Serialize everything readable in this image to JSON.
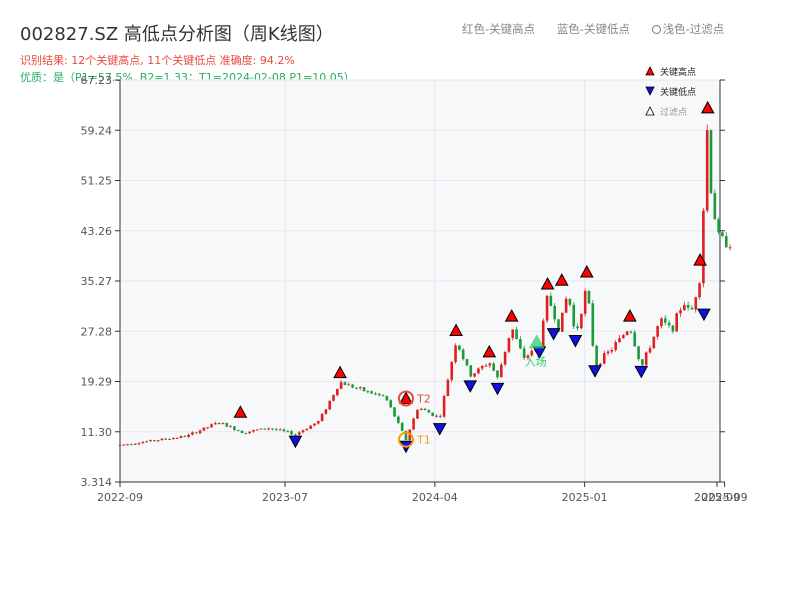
{
  "header": {
    "title": "002827.SZ 高低点分析图（周K线图）",
    "line1": "识别结果: 12个关键高点, 11个关键低点  准确度: 94.2%",
    "line2": "优质：是（P1=57.5%, B2=1.33；T1=2024-02-08 P1=10.05）"
  },
  "top_legend": {
    "red": "红色-关键高点",
    "blue": "蓝色-关键低点",
    "light": "浅色-过滤点"
  },
  "colors": {
    "up": "#e02020",
    "down": "#1a9a3a",
    "high_marker": "#ff0000",
    "low_marker": "#1010e0",
    "t_orange": "#f39c12",
    "t_red": "#e74c3c",
    "entry": "#2ecc71",
    "plot_bg": "#f6f8fa"
  },
  "chart_data": {
    "type": "candlestick",
    "title": "002827.SZ 高低点分析图（周K线图）",
    "xlabel": "",
    "ylabel": "",
    "x_range": [
      "2022-09",
      "2025-09"
    ],
    "x_ticks": [
      "2022-09",
      "2023-07",
      "2024-04",
      "2025-01",
      "2025-09",
      "2025-09"
    ],
    "y_ticks": [
      3.314,
      11.3,
      19.29,
      27.28,
      35.27,
      43.26,
      51.25,
      59.24,
      67.23
    ],
    "y_tick_labels": [
      "3.314",
      "11.30",
      "19.29",
      "27.28",
      "35.27",
      "43.26",
      "51.25",
      "59.24",
      "67.23"
    ],
    "ylim": [
      3.314,
      67.23
    ],
    "grid": true,
    "legend": [
      {
        "name": "关键高点",
        "marker": "triangle-up",
        "color": "#ff0000"
      },
      {
        "name": "关键低点",
        "marker": "triangle-down",
        "color": "#1010e0"
      },
      {
        "name": "过滤点",
        "marker": "triangle-up-outline",
        "color": "#ffffff"
      }
    ],
    "legend_position": "top-right",
    "anchors": [
      [
        "2022-09-01",
        9.2
      ],
      [
        "2022-11-01",
        9.9
      ],
      [
        "2023-01-01",
        10.6
      ],
      [
        "2023-03-01",
        12.8
      ],
      [
        "2023-04-15",
        11.2
      ],
      [
        "2023-06-01",
        11.9
      ],
      [
        "2023-07-20",
        10.9
      ],
      [
        "2023-09-01",
        13.0
      ],
      [
        "2023-10-10",
        19.2
      ],
      [
        "2023-11-20",
        17.9
      ],
      [
        "2024-01-01",
        16.8
      ],
      [
        "2024-02-08",
        10.05
      ],
      [
        "2024-03-01",
        15.2
      ],
      [
        "2024-04-10",
        13.5
      ],
      [
        "2024-05-10",
        25.8
      ],
      [
        "2024-06-05",
        20.2
      ],
      [
        "2024-07-10",
        22.4
      ],
      [
        "2024-07-25",
        19.8
      ],
      [
        "2024-08-20",
        28.0
      ],
      [
        "2024-09-10",
        23.0
      ],
      [
        "2024-10-10",
        24.8
      ],
      [
        "2024-10-25",
        33.0
      ],
      [
        "2024-11-15",
        27.5
      ],
      [
        "2024-12-01",
        33.5
      ],
      [
        "2024-12-15",
        26.5
      ],
      [
        "2025-01-05",
        34.5
      ],
      [
        "2025-01-20",
        21.8
      ],
      [
        "2025-02-20",
        24.5
      ],
      [
        "2025-03-25",
        28.0
      ],
      [
        "2025-04-15",
        21.5
      ],
      [
        "2025-05-20",
        29.0
      ],
      [
        "2025-06-10",
        27.5
      ],
      [
        "2025-07-01",
        32.0
      ],
      [
        "2025-07-15",
        30.0
      ],
      [
        "2025-08-01",
        36.0
      ],
      [
        "2025-08-15",
        61.0
      ],
      [
        "2025-08-22",
        48.0
      ],
      [
        "2025-09-05",
        42.0
      ],
      [
        "2025-09-30",
        41.0
      ]
    ],
    "key_highs": [
      [
        "2023-04-10",
        13.6
      ],
      [
        "2023-10-10",
        19.9
      ],
      [
        "2024-02-08",
        15.8
      ],
      [
        "2024-05-10",
        26.6
      ],
      [
        "2024-07-10",
        23.2
      ],
      [
        "2024-08-20",
        28.9
      ],
      [
        "2024-10-25",
        34.0
      ],
      [
        "2024-11-20",
        34.6
      ],
      [
        "2025-01-05",
        35.9
      ],
      [
        "2025-03-25",
        28.9
      ],
      [
        "2025-08-01",
        37.8
      ],
      [
        "2025-08-15",
        62.0
      ]
    ],
    "key_lows": [
      [
        "2023-07-20",
        10.6
      ],
      [
        "2024-02-08",
        9.8
      ],
      [
        "2024-04-10",
        12.6
      ],
      [
        "2024-06-05",
        19.4
      ],
      [
        "2024-07-25",
        19.0
      ],
      [
        "2024-10-10",
        24.8
      ],
      [
        "2024-11-05",
        27.7
      ],
      [
        "2024-12-15",
        26.6
      ],
      [
        "2025-01-20",
        21.8
      ],
      [
        "2025-04-15",
        21.7
      ],
      [
        "2025-08-08",
        30.8
      ]
    ],
    "annotations": [
      {
        "label": "T1",
        "date": "2024-02-08",
        "value": 10.05
      },
      {
        "label": "T2",
        "date": "2024-02-08",
        "value": 16.6
      },
      {
        "label": "入场",
        "date": "2024-10-05",
        "value": 25.2
      }
    ]
  }
}
